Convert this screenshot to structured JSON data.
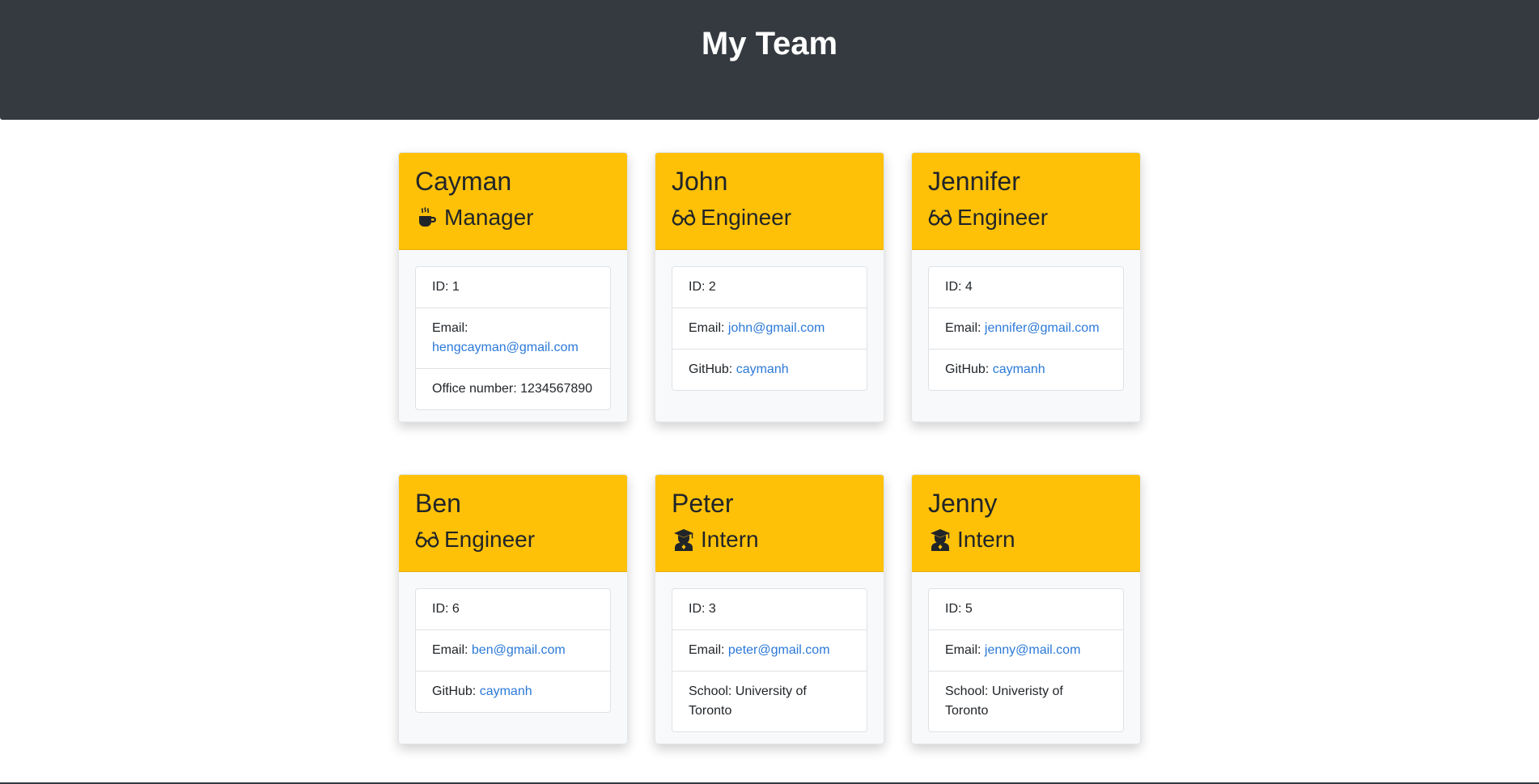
{
  "header": {
    "title": "My Team"
  },
  "team": [
    {
      "name": "Cayman",
      "role": "Manager",
      "icon": "coffee-icon",
      "id_label": "ID: 1",
      "email_label": "Email:",
      "email": "hengcayman@gmail.com",
      "extra_label": "Office number:",
      "extra_value": "1234567890",
      "extra_is_link": false
    },
    {
      "name": "John",
      "role": "Engineer",
      "icon": "glasses-icon",
      "id_label": "ID: 2",
      "email_label": "Email:",
      "email": "john@gmail.com",
      "extra_label": "GitHub:",
      "extra_value": "caymanh",
      "extra_is_link": true
    },
    {
      "name": "Jennifer",
      "role": "Engineer",
      "icon": "glasses-icon",
      "id_label": "ID: 4",
      "email_label": "Email:",
      "email": "jennifer@gmail.com",
      "extra_label": "GitHub:",
      "extra_value": "caymanh",
      "extra_is_link": true
    },
    {
      "name": "Ben",
      "role": "Engineer",
      "icon": "glasses-icon",
      "id_label": "ID: 6",
      "email_label": "Email:",
      "email": "ben@gmail.com",
      "extra_label": "GitHub:",
      "extra_value": "caymanh",
      "extra_is_link": true
    },
    {
      "name": "Peter",
      "role": "Intern",
      "icon": "graduate-icon",
      "id_label": "ID: 3",
      "email_label": "Email:",
      "email": "peter@gmail.com",
      "extra_label": "School:",
      "extra_value": "University of Toronto",
      "extra_is_link": false
    },
    {
      "name": "Jenny",
      "role": "Intern",
      "icon": "graduate-icon",
      "id_label": "ID: 5",
      "email_label": "Email:",
      "email": "jenny@mail.com",
      "extra_label": "School:",
      "extra_value": "Univeristy of Toronto",
      "extra_is_link": false
    }
  ],
  "colors": {
    "header_bg": "#343a40",
    "card_header": "#ffc107",
    "link": "#2b79d8"
  }
}
